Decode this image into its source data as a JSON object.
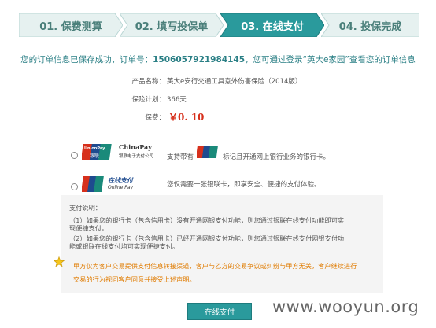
{
  "steps": [
    {
      "label": "01. 保费测算",
      "active": false
    },
    {
      "label": "02. 填写投保单",
      "active": false
    },
    {
      "label": "03. 在线支付",
      "active": true
    },
    {
      "label": "04. 投保完成",
      "active": false
    }
  ],
  "notice": {
    "prefix": "您的订单信息已保存成功，订单号：",
    "order_no": "1506057921984145",
    "middle": "，您可通过登录",
    "home_link": "“英大e家园”",
    "suffix": "查看您的订单信息"
  },
  "order": {
    "product_label": "产品名称：",
    "product_value": "英大e安行交通工具意外伤害保险（2014版）",
    "plan_label": "保险计划：",
    "plan_value": "366天",
    "premium_label": "保费：",
    "premium_value": "￥0. 10"
  },
  "payments": [
    {
      "logo_title": "ChinaPay",
      "logo_sub": "银联电子支付公司",
      "desc_prefix": "支持带有",
      "desc_suffix": "标记且开通网上银行业务的银行卡。"
    },
    {
      "logo_title": "在线支付",
      "logo_sub": "Online Pay",
      "desc": "您仅需要一张银联卡，即享安全、便捷的支付体验。"
    }
  ],
  "unionpay_brand": {
    "en": "UnionPay",
    "cn": "银联"
  },
  "explain": {
    "title": "支付说明：",
    "line1a": "（1）如果您的银行卡（包含信用卡）没有开通网银支付功能，则您通过银联在线支付功能即可实",
    "line1b": "现便捷支付。",
    "line2a": "（2）如果您的银行卡（包含信用卡）已经开通网银支付功能，则您通过银联在线支付网银支付功",
    "line2b": "能或银联在线支付均可实现便捷支付。"
  },
  "warning": {
    "line1": "甲方仅为客户交易提供支付信息转接渠道，客户与乙方的交易争议或纠纷与甲方无关，客户继续进行",
    "line2": "交易的行为视同客户同意并接受上述声明。"
  },
  "pay_button": "在线支付",
  "watermark": "www.wooyun.org",
  "colors": {
    "step_active": "#2a9a9c",
    "step_inactive": "#e6f1f0",
    "teal_text": "#2a7f85",
    "price": "#d7301c",
    "warning": "#e07b00"
  }
}
